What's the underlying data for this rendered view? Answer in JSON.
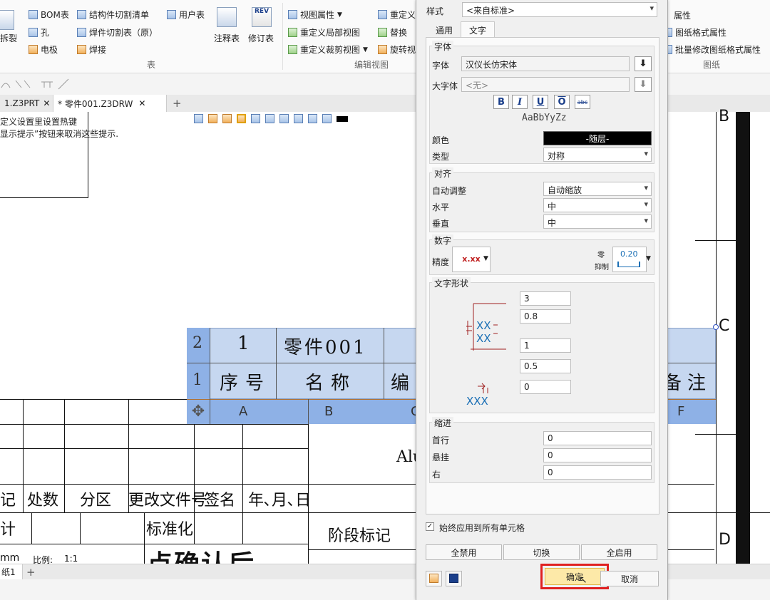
{
  "ribbon": {
    "split_label": "拆裂",
    "bom": "BOM表",
    "hole": "孔",
    "electrode": "电极",
    "cut_list": "结构件切割清单",
    "weld_cut": "焊件切割表（原）",
    "weld": "焊接",
    "user_table": "用户表",
    "annot_table": "注释表",
    "rev_table": "修订表",
    "rev_icon_text": "REV",
    "group_table": "表",
    "view_props": "视图属性",
    "redefine_local": "重定义局部视图",
    "redefine_clip": "重定义裁剪视图",
    "redefine": "重定义",
    "replace": "替换",
    "rotate": "旋转视",
    "group_edit": "编辑视图",
    "props": "属性",
    "sheet_fmt": "图纸格式属性",
    "batch_fmt": "批量修改图纸格式属性",
    "group_sheet": "图纸"
  },
  "tabs": {
    "tab1": "1.Z3PRT",
    "tab2": "* 零件001.Z3DRW",
    "close": "✕",
    "add": "+"
  },
  "hint": {
    "line1": "定义设置里设置热键",
    "line2": "显示提示”按钮来取消这些提示."
  },
  "table": {
    "row2_num": "2",
    "row1_num": "1",
    "r2_c1": "1",
    "r2_c2": "零件001",
    "r1_c1": "序号",
    "r1_c2": "名称",
    "r1_c3": "编",
    "r1_c6": "备注",
    "col_a": "A",
    "col_b": "B",
    "col_c": "C",
    "col_f": "F"
  },
  "titleblock": {
    "mark": "记",
    "count": "处数",
    "zone": "分区",
    "change_doc": "更改文件号",
    "sign": "签名",
    "date": "年､月､日",
    "design": "设计",
    "standard": "标准化",
    "stage": "阶段标记",
    "alu": "Alu",
    "mm": "mm",
    "scale": "比例:",
    "scale_val": "1:1"
  },
  "side_marks": {
    "b": "B",
    "c": "C",
    "d": "D"
  },
  "sheet_tab": "纸1",
  "caption": "点确认后",
  "dialog": {
    "style_label": "样式",
    "style_value": "<来自标准>",
    "tab_general": "通用",
    "tab_text": "文字",
    "font_section": "字体",
    "font_label": "字体",
    "font_value": "汉仪长仿宋体",
    "bigfont_label": "大字体",
    "bigfont_value": "<无>",
    "bold": "B",
    "italic": "I",
    "underline": "U",
    "overline": "O",
    "strike": "abc",
    "preview": "AaBbYyZz",
    "color_label": "颜色",
    "color_value": "-随层-",
    "type_label": "类型",
    "type_value": "对称",
    "align_section": "对齐",
    "auto_label": "自动调整",
    "auto_value": "自动缩放",
    "horiz_label": "水平",
    "horiz_value": "中",
    "vert_label": "垂直",
    "vert_value": "中",
    "num_section": "数字",
    "precision_label": "精度",
    "precision_value": "x.xx",
    "zero_label_1": "零",
    "zero_label_2": "抑制",
    "zero_value": "0.20",
    "shape_section": "文字形状",
    "shape_v1": "3",
    "shape_v2": "0.8",
    "shape_v3": "1",
    "shape_v4": "0.5",
    "shape_v5": "0",
    "indent_section": "缩进",
    "first_label": "首行",
    "first_value": "0",
    "hang_label": "悬挂",
    "hang_value": "0",
    "right_label": "右",
    "right_value": "0",
    "apply_all": "始终应用到所有单元格",
    "disable_all": "全禁用",
    "toggle": "切换",
    "enable_all": "全启用",
    "ok": "确定",
    "cancel": "取消"
  },
  "colors": {
    "table_fill": "#c6d7f0",
    "table_header": "#8eb1e6",
    "highlight_red": "#e02020",
    "ok_fill": "#fde9a8"
  }
}
